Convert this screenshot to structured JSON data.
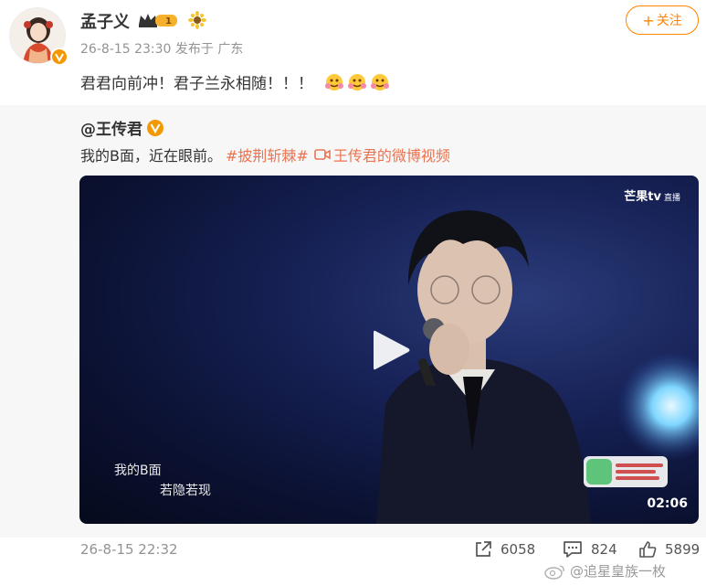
{
  "post": {
    "author_name": "孟子义",
    "level_badge": "1",
    "meta": "26-8-15 23:30 发布于 广东",
    "follow_label": "关注",
    "text": "君君向前冲！君子兰永相随！！！"
  },
  "repost": {
    "author": "@王传君",
    "text": "我的B面，近在眼前。",
    "topic": "#披荆斩棘#",
    "video_link": "王传君的微博视频",
    "video": {
      "channel_logo": "芒果tv",
      "channel_live": "直播",
      "subtitle_1": "我的B面",
      "subtitle_2": "若隐若现",
      "duration": "02:06"
    },
    "time": "26-8-15 22:32",
    "stats": {
      "reposts": "6058",
      "comments": "824",
      "likes": "5899"
    }
  },
  "watermark": "@追星皇族一枚",
  "colors": {
    "accent": "#ff8200",
    "topic": "#eb7350",
    "repost_bg": "#f7f7f7"
  }
}
